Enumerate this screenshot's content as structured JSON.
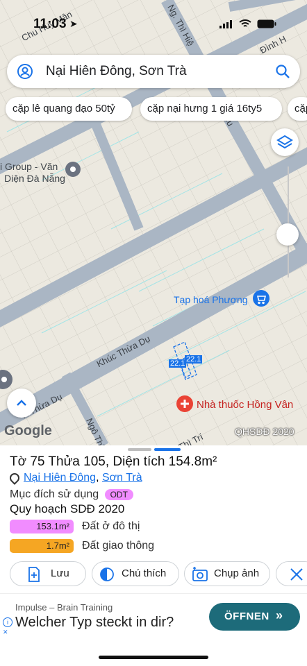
{
  "status": {
    "time": "11:03",
    "location_arrow": "location-arrow-icon"
  },
  "search": {
    "query": "Nại Hiên Đông, Sơn Trà"
  },
  "chips": [
    "cặp lê quang đạo 50tỷ",
    "cặp nại hưng 1 giá 16ty5",
    "cặp"
  ],
  "map": {
    "labels": {
      "group": "i Group - Văn",
      "group2": "Diện Đà Nẵng",
      "shop": "Tạp hoá Phượng",
      "pharmacy": "Nhà thuốc Hồng Vân",
      "google": "Google",
      "qhsdd": "QHSDĐ 2020"
    },
    "roads": {
      "khuc_thua_du": "Khúc Thừa Dụ",
      "khuc_thua_du_2": "K Thừa Dụ",
      "ngo_thi": "Ngô Thì",
      "thi_tri": "Thì Trí",
      "thi_hieu": "Ng. Thì Hiệ",
      "hieu": "iệu",
      "chu_huy_man": "Chu Huy Mân",
      "dinh": "Đình H"
    },
    "parcel_labels": [
      "22.1",
      "22.1"
    ]
  },
  "sheet": {
    "title": "Tờ 75 Thửa 105, Diện tích 154.8m²",
    "address_ward": "Nại Hiên Đông",
    "address_sep": ",",
    "address_district": "Sơn Trà",
    "purpose_label": "Mục đích sử dụng",
    "purpose_tag": "ODT",
    "plan_title": "Quy hoạch SDĐ 2020",
    "plan_items": [
      {
        "value": "153.1m²",
        "label": "Đất ở đô thị",
        "color": "#f18cff"
      },
      {
        "value": "1.7m²",
        "label": "Đất giao thông",
        "color": "#f5a623"
      }
    ],
    "actions": [
      "Lưu",
      "Chú thích",
      "Chụp ảnh"
    ]
  },
  "ad": {
    "brand": "Impulse – Brain Training",
    "headline": "Welcher Typ steckt in dir?",
    "cta": "ÖFFNEN"
  },
  "colors": {
    "accent": "#1a73e8",
    "cta_bg": "#1d6b7a"
  }
}
